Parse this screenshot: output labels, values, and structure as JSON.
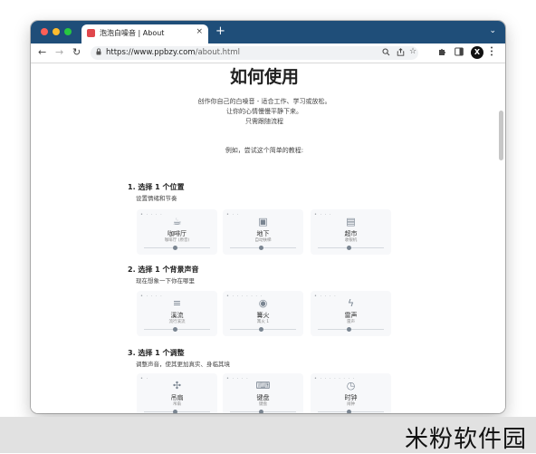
{
  "browser": {
    "tab_title": "泡泡白噪音 | About",
    "tab_close": "×",
    "new_tab": "+",
    "tab_menu": "⌄",
    "back": "←",
    "forward": "→",
    "reload": "↻",
    "url_host": "https://www.ppbzy.com",
    "url_path": "/about.html",
    "profile_badge": "X"
  },
  "page": {
    "title": "如何使用",
    "intro_lines": [
      "创作你自己的白噪音 - 适合工作、学习或放松。",
      "让你的心情慢慢平静下来。",
      "只需跟随流程"
    ],
    "example_text": "例如，尝试这个简单的教程:"
  },
  "steps": [
    {
      "title": "1. 选择 1 个位置",
      "subtitle": "设置情绪和节奏",
      "cards": [
        {
          "icon": "coffee-icon",
          "glyph": "☕",
          "dots": "•  ·  ·  ·  ·",
          "name": "咖啡厅",
          "desc": "咖啡厅 (原音)",
          "level": 0.5
        },
        {
          "icon": "subway-icon",
          "glyph": "▣",
          "dots": "•  ·  ·",
          "name": "地下",
          "desc": "自动扶梯",
          "level": 0.5
        },
        {
          "icon": "shopping-bag-icon",
          "glyph": "▤",
          "dots": "•  ·  ·  ·",
          "name": "超市",
          "desc": "收银机",
          "level": 0.5
        }
      ]
    },
    {
      "title": "2. 选择 1 个背景声音",
      "subtitle": "现在想象一下你在哪里",
      "cards": [
        {
          "icon": "stream-icon",
          "glyph": "≡",
          "dots": "•  ·  ·  ·  ·",
          "name": "溪流",
          "desc": "流行溪流",
          "level": 0.5
        },
        {
          "icon": "fire-icon",
          "glyph": "◉",
          "dots": "•  ·  ·  ·  ·  ·  ·  ·",
          "name": "篝火",
          "desc": "篝火 1",
          "level": 0.5
        },
        {
          "icon": "lightning-icon",
          "glyph": "ϟ",
          "dots": "•  ·  ·  ·  ·",
          "name": "雷声",
          "desc": "雷声",
          "level": 0.5
        }
      ]
    },
    {
      "title": "3. 选择 1 个调整",
      "subtitle": "调整声音，使其更加真实、身临其境",
      "cards": [
        {
          "icon": "fan-icon",
          "glyph": "✣",
          "dots": "•  ·",
          "name": "吊扇",
          "desc": "吊扇",
          "level": 0.5
        },
        {
          "icon": "keyboard-icon",
          "glyph": "⌨",
          "dots": "•  ·  ·  ·  ·",
          "name": "键盘",
          "desc": "键盘",
          "level": 0.5
        },
        {
          "icon": "clock-icon",
          "glyph": "◷",
          "dots": "•  ·  ·  ·  ·  ·  ·  ·  ·",
          "name": "时钟",
          "desc": "闹钟",
          "level": 0.5
        }
      ]
    }
  ],
  "watermark": "米粉软件园"
}
